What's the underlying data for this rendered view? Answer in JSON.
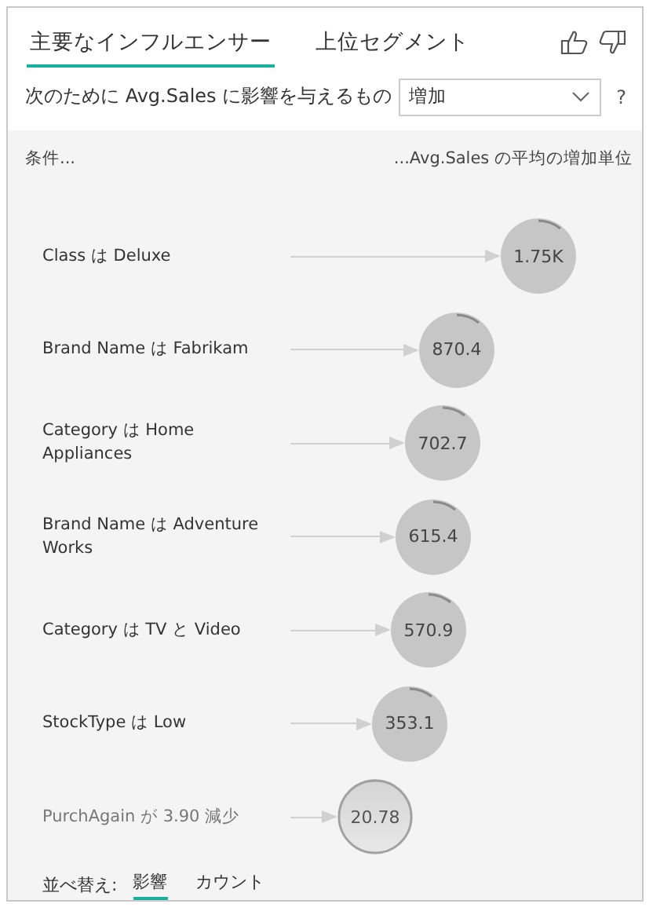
{
  "tabs": [
    {
      "label": "主要なインフルエンサー",
      "selected": true
    },
    {
      "label": "上位セグメント",
      "selected": false
    }
  ],
  "filter": {
    "label": "次のために Avg.Sales に影響を与えるもの",
    "value": "増加",
    "help": "?"
  },
  "panel": {
    "left_header": "条件...",
    "right_header": "...Avg.Sales の平均の増加単位",
    "influencers": [
      {
        "kind": "increase",
        "label": "Class は Deluxe",
        "value": "1.75K"
      },
      {
        "kind": "increase",
        "label": "Brand Name は Fabrikam",
        "value": "870.4"
      },
      {
        "kind": "increase",
        "label": "Category は Home Appliances",
        "value": "702.7"
      },
      {
        "kind": "increase",
        "label": "Brand Name は Adventure Works",
        "value": "615.4"
      },
      {
        "kind": "increase",
        "label": "Category は TV と Video",
        "value": "570.9"
      },
      {
        "kind": "increase",
        "label": "StockType は Low",
        "value": "353.1"
      },
      {
        "kind": "decrease",
        "label": "PurchAgain が 3.90 減少",
        "value": "20.78"
      }
    ],
    "sort": {
      "label": "並べ替え:",
      "options": [
        {
          "label": "影響",
          "selected": true
        },
        {
          "label": "カウント",
          "selected": false
        }
      ]
    }
  }
}
